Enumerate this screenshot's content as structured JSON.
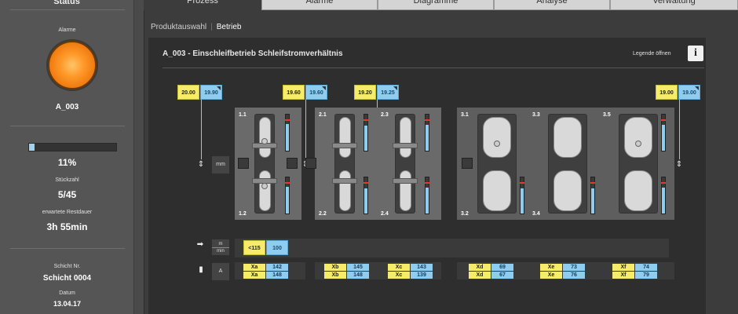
{
  "sidebar": {
    "title": "Status",
    "alarm_label": "Alarme",
    "alarm_program": "A_003",
    "progress_fraction": 0.06,
    "progress_text": "11%",
    "count_label": "Stückzahl",
    "count_value": "5/45",
    "remaining_label": "erwartete Restdauer",
    "remaining_value": "3h 55min",
    "shift_label": "Schicht Nr.",
    "shift_value": "Schicht 0004",
    "date_label": "Datum",
    "date_value": "13.04.17",
    "colors": {
      "alarm": "#ff9a2a",
      "progress": "#9fd3f2"
    }
  },
  "tabs": [
    {
      "label": "Prozess",
      "active": true
    },
    {
      "label": "Alarme",
      "active": false
    },
    {
      "label": "Diagramme",
      "active": false
    },
    {
      "label": "Analyse",
      "active": false
    },
    {
      "label": "Verwaltung",
      "active": false
    }
  ],
  "subnav": {
    "item1": "Produktauswahl",
    "item2": "Betrieb"
  },
  "panel": {
    "title": "A_003 - Einschleifbetrieb Schleifstromverhältnis",
    "legend_link": "Legende öffnen",
    "info_icon": "i"
  },
  "setpoints": [
    {
      "yellow": "20.00",
      "blue": "19.90"
    },
    {
      "yellow": "19.60",
      "blue": "19.60"
    },
    {
      "yellow": "19.20",
      "blue": "19.25"
    },
    {
      "yellow": "19.00",
      "blue": "19.00"
    }
  ],
  "slots": [
    "1.1",
    "1.2",
    "2.1",
    "2.2",
    "2.3",
    "2.4",
    "3.1",
    "3.2",
    "3.3",
    "3.4",
    "3.5"
  ],
  "mm_label": "mm",
  "speed": {
    "unit_top": "m",
    "unit_bottom": "min",
    "yellow": "<115",
    "blue": "100"
  },
  "current": {
    "unit": "A",
    "groups": [
      {
        "rows": [
          {
            "name": "Xa",
            "value": "142"
          },
          {
            "name": "Xa",
            "value": "148"
          }
        ]
      },
      {
        "rows": [
          {
            "name": "Xb",
            "value": "145"
          },
          {
            "name": "Xb",
            "value": "148"
          }
        ]
      },
      {
        "rows": [
          {
            "name": "Xc",
            "value": "143"
          },
          {
            "name": "Xc",
            "value": "139"
          }
        ]
      },
      {
        "rows": [
          {
            "name": "Xd",
            "value": "69"
          },
          {
            "name": "Xd",
            "value": "67"
          }
        ]
      },
      {
        "rows": [
          {
            "name": "Xe",
            "value": "73"
          },
          {
            "name": "Xe",
            "value": "76"
          }
        ]
      },
      {
        "rows": [
          {
            "name": "Xf",
            "value": "74"
          },
          {
            "name": "Xf",
            "value": "79"
          }
        ]
      }
    ]
  },
  "icons": {
    "alarm": "alarm-lamp-icon",
    "info": "info-icon",
    "mm": "gap-arrows-icon",
    "speed": "feed-arrow-icon",
    "current": "battery-icon"
  }
}
